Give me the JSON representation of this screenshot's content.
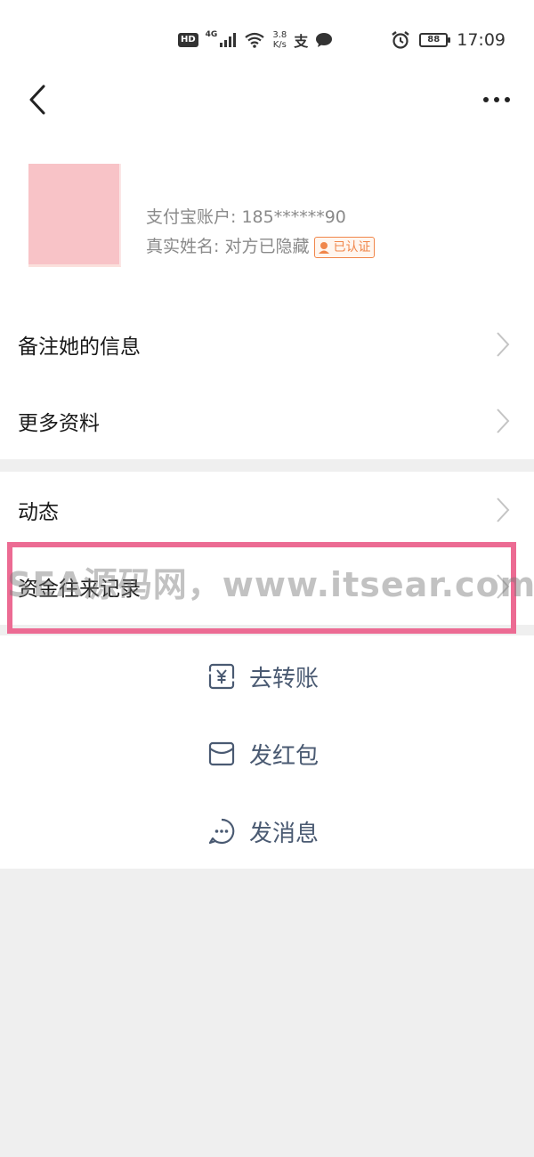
{
  "status_bar": {
    "hd": "HD",
    "network": "4G",
    "speed_value": "3.8",
    "speed_unit": "K/s",
    "alipay_glyph": "支",
    "battery": "88",
    "time": "17:09",
    "icons": [
      "signal-icon",
      "wifi-icon",
      "chat-bubble-icon",
      "alarm-icon",
      "battery-icon"
    ]
  },
  "nav": {
    "back_icon": "chevron-left-icon",
    "more_icon": "more-dots-icon"
  },
  "profile": {
    "account_label": "支付宝账户: 185******90",
    "realname_label": "真实姓名: 对方已隐藏",
    "verified_text": "已认证"
  },
  "menu": {
    "section1": [
      {
        "label": "备注她的信息"
      },
      {
        "label": "更多资料"
      }
    ],
    "section2": [
      {
        "label": "动态"
      },
      {
        "label": "资金往来记录"
      }
    ]
  },
  "watermark": "SEA源码网，www.itsear.com",
  "actions": [
    {
      "label": "去转账",
      "icon": "transfer-yuan-icon"
    },
    {
      "label": "发红包",
      "icon": "red-envelope-icon"
    },
    {
      "label": "发消息",
      "icon": "message-icon"
    }
  ],
  "colors": {
    "highlight": "#ec6b93",
    "verified": "#f0864a",
    "action_text": "#4a5a72",
    "background": "#efefef"
  }
}
